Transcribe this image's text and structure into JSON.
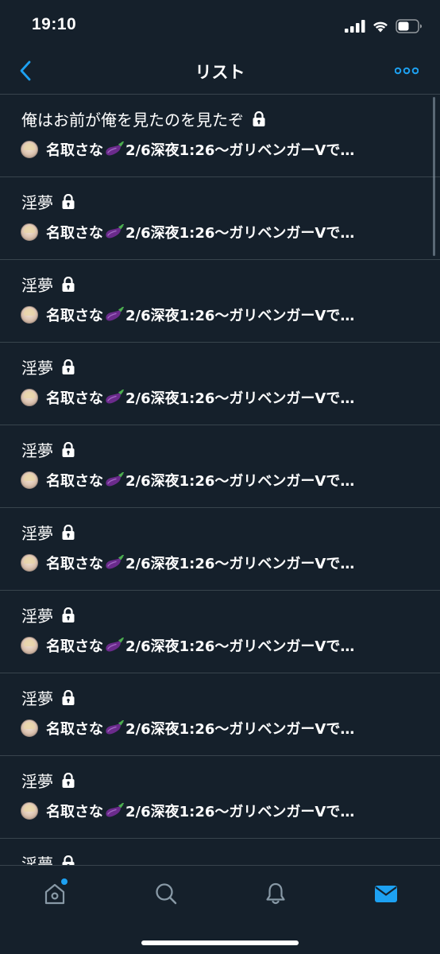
{
  "status_bar": {
    "time": "19:10"
  },
  "nav": {
    "title": "リスト"
  },
  "colors": {
    "background": "#15202b",
    "divider": "#38444d",
    "accent": "#1da1f2",
    "icon_muted": "#8899a6"
  },
  "lists": [
    {
      "title": "俺はお前が俺を見たのを見たぞ",
      "owner": "名取さな",
      "bio": "2/6深夜1:26〜ガリベンガーVで…",
      "private": true,
      "avatar_icon": "avatar-icon",
      "emoji_icon": "eggplant-icon"
    },
    {
      "title": "淫夢",
      "owner": "名取さな",
      "bio": "2/6深夜1:26〜ガリベンガーVで…",
      "private": true,
      "avatar_icon": "avatar-icon",
      "emoji_icon": "eggplant-icon"
    },
    {
      "title": "淫夢",
      "owner": "名取さな",
      "bio": "2/6深夜1:26〜ガリベンガーVで…",
      "private": true,
      "avatar_icon": "avatar-icon",
      "emoji_icon": "eggplant-icon"
    },
    {
      "title": "淫夢",
      "owner": "名取さな",
      "bio": "2/6深夜1:26〜ガリベンガーVで…",
      "private": true,
      "avatar_icon": "avatar-icon",
      "emoji_icon": "eggplant-icon"
    },
    {
      "title": "淫夢",
      "owner": "名取さな",
      "bio": "2/6深夜1:26〜ガリベンガーVで…",
      "private": true,
      "avatar_icon": "avatar-icon",
      "emoji_icon": "eggplant-icon"
    },
    {
      "title": "淫夢",
      "owner": "名取さな",
      "bio": "2/6深夜1:26〜ガリベンガーVで…",
      "private": true,
      "avatar_icon": "avatar-icon",
      "emoji_icon": "eggplant-icon"
    },
    {
      "title": "淫夢",
      "owner": "名取さな",
      "bio": "2/6深夜1:26〜ガリベンガーVで…",
      "private": true,
      "avatar_icon": "avatar-icon",
      "emoji_icon": "eggplant-icon"
    },
    {
      "title": "淫夢",
      "owner": "名取さな",
      "bio": "2/6深夜1:26〜ガリベンガーVで…",
      "private": true,
      "avatar_icon": "avatar-icon",
      "emoji_icon": "eggplant-icon"
    },
    {
      "title": "淫夢",
      "owner": "名取さな",
      "bio": "2/6深夜1:26〜ガリベンガーVで…",
      "private": true,
      "avatar_icon": "avatar-icon",
      "emoji_icon": "eggplant-icon"
    },
    {
      "title": "淫夢",
      "owner": "",
      "bio": "",
      "private": true,
      "avatar_icon": "",
      "emoji_icon": ""
    }
  ],
  "tab_bar": {
    "tabs": [
      {
        "icon": "home-icon",
        "active": false,
        "has_badge": true
      },
      {
        "icon": "search-icon",
        "active": false,
        "has_badge": false
      },
      {
        "icon": "bell-icon",
        "active": false,
        "has_badge": false
      },
      {
        "icon": "mail-icon",
        "active": true,
        "has_badge": false
      }
    ]
  }
}
